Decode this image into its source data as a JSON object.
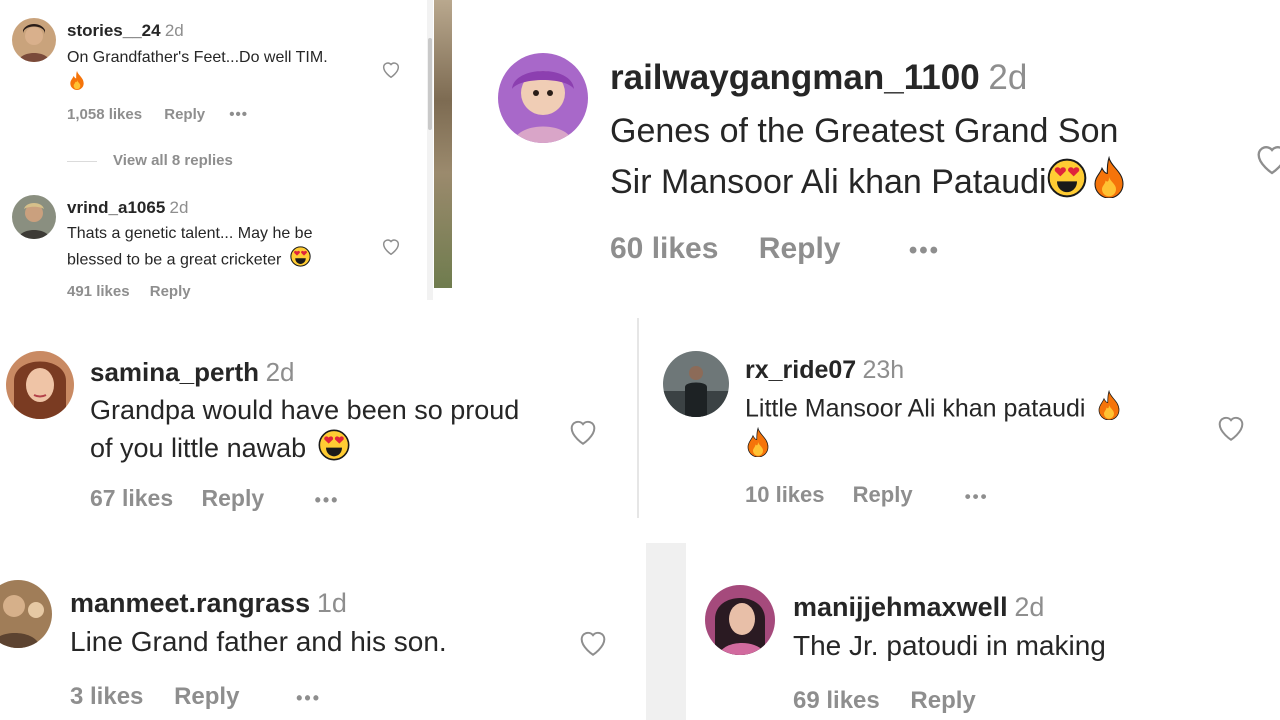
{
  "comments": [
    {
      "username": "stories__24",
      "time": "2d",
      "text1": "On Grandfather's Feet...Do well TIM.",
      "text2": "",
      "likes": "1,058 likes",
      "reply": "Reply",
      "more": "•••",
      "replies": "View all 8 replies"
    },
    {
      "username": "vrind_a1065",
      "time": "2d",
      "text1": "Thats a genetic talent... May he be",
      "text2": "blessed to be a great cricketer",
      "likes": "491 likes",
      "reply": "Reply"
    },
    {
      "username": "railwaygangman_1100",
      "time": "2d",
      "text1": "Genes of the Greatest Grand Son",
      "text2": "Sir Mansoor Ali khan Pataudi",
      "likes": "60 likes",
      "reply": "Reply",
      "more": "•••"
    },
    {
      "username": "samina_perth",
      "time": "2d",
      "text1": "Grandpa would have been so proud",
      "text2": "of you little nawab",
      "likes": "67 likes",
      "reply": "Reply",
      "more": "•••"
    },
    {
      "username": "rx_ride07",
      "time": "23h",
      "text1": "Little Mansoor Ali khan pataudi",
      "text2": "",
      "likes": "10 likes",
      "reply": "Reply",
      "more": "•••"
    },
    {
      "username": "manmeet.rangrass",
      "time": "1d",
      "text1": "Line Grand father and his son.",
      "text2": "",
      "likes": "3 likes",
      "reply": "Reply",
      "more": "•••"
    },
    {
      "username": "manijjehmaxwell",
      "time": "2d",
      "text1": "The Jr. patoudi in making",
      "text2": "",
      "likes": "69 likes",
      "reply": "Reply"
    }
  ],
  "colors": {
    "text": "#262626",
    "muted": "#8e8e8e",
    "fire": "#f5740a",
    "emoji_face": "#ffcc33",
    "heart_eyes": "#e0243b"
  }
}
